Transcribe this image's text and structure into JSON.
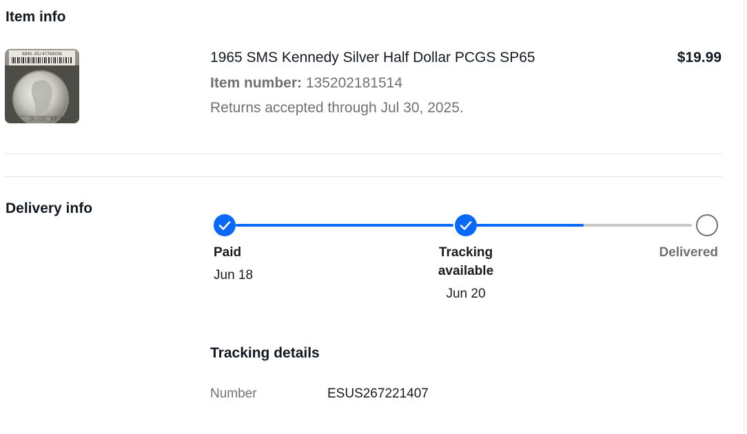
{
  "item_info": {
    "heading": "Item info",
    "title": "1965 SMS Kennedy Silver Half Dollar PCGS SP65",
    "price": "$19.99",
    "item_number_label": "Item number:",
    "item_number": "135202181514",
    "returns_text": "Returns accepted through Jul 30, 2025.",
    "thumbnail_label": "6845.65/47760336"
  },
  "delivery_info": {
    "heading": "Delivery info",
    "steps": [
      {
        "label": "Paid",
        "date": "Jun 18",
        "status": "complete"
      },
      {
        "label_line1": "Tracking",
        "label_line2": "available",
        "date": "Jun 20",
        "status": "complete"
      },
      {
        "label": "Delivered",
        "date": "",
        "status": "pending"
      }
    ],
    "progress_second_segment": 0.5,
    "colors": {
      "complete": "#0968f6",
      "pending": "#c7c7c7"
    }
  },
  "tracking": {
    "heading": "Tracking details",
    "number_label": "Number",
    "number": "ESUS267221407"
  }
}
